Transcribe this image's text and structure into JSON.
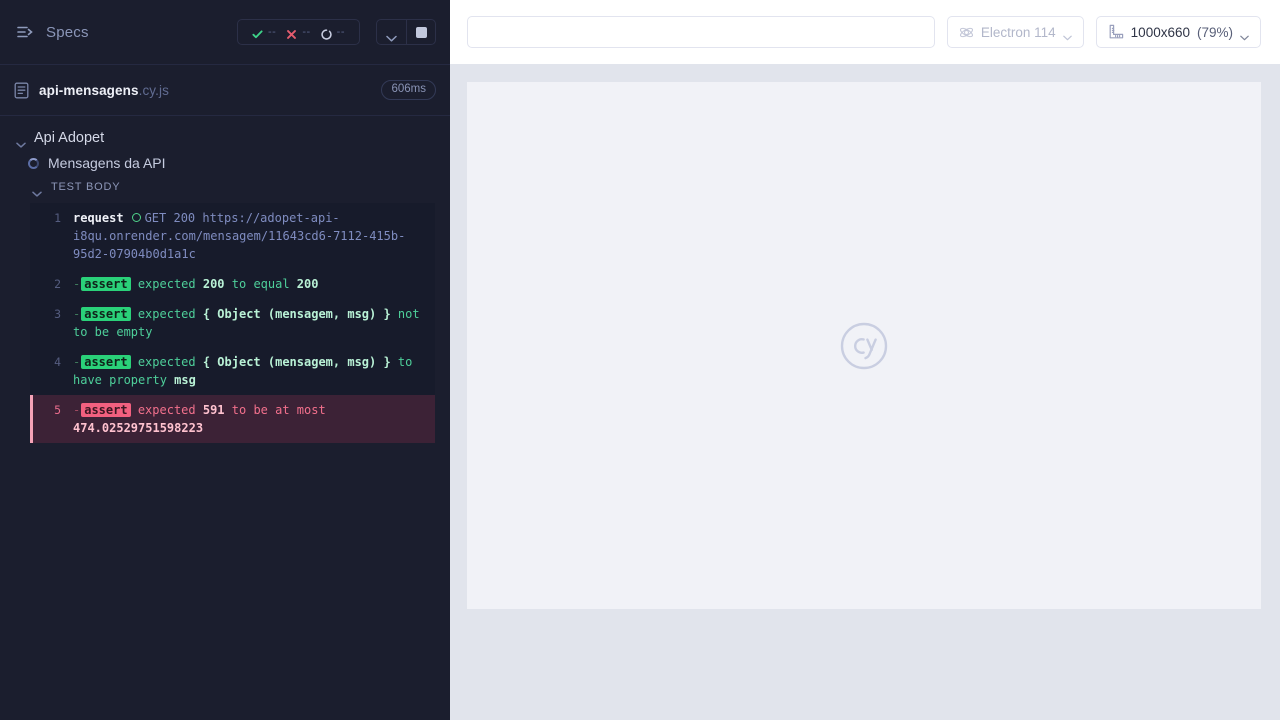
{
  "reporter": {
    "header": {
      "specs_label": "Specs",
      "specs_icon": "specs-list-icon",
      "stats": [
        {
          "icon": "passed-check-icon",
          "value": "--",
          "name": "passed"
        },
        {
          "icon": "failed-x-icon",
          "value": "--",
          "name": "failed"
        },
        {
          "icon": "pending-circle-icon",
          "value": "--",
          "name": "pending"
        }
      ],
      "controls": [
        {
          "icon": "chevron-down-icon",
          "name": "toggle-specs-list"
        },
        {
          "icon": "stop-square-icon",
          "name": "stop-run"
        }
      ]
    },
    "spec": {
      "icon": "file-icon",
      "name": "api-mensagens",
      "extension": ".cy.js",
      "duration": "606ms"
    },
    "suite": {
      "caret_icon": "chevron-down-icon",
      "title": "Api Adopet",
      "test": {
        "status_icon": "running-spinner-icon",
        "title": "Mensagens da API"
      },
      "hook": {
        "caret_icon": "chevron-down-icon",
        "label": "TEST BODY"
      }
    },
    "commands": [
      {
        "number": "1",
        "type": "request",
        "method": "request",
        "status_icon": "green-circle-icon",
        "detail": "GET 200 https://adopet-api-i8qu.onrender.com/mensagem/11643cd6-7112-415b-95d2-07904b0d1a1c",
        "failed": false
      },
      {
        "number": "2",
        "type": "assert",
        "pill": "assert",
        "parts": [
          {
            "t": "expected ",
            "strong": false
          },
          {
            "t": "200",
            "strong": true
          },
          {
            "t": " to equal ",
            "strong": false
          },
          {
            "t": "200",
            "strong": true
          }
        ],
        "failed": false
      },
      {
        "number": "3",
        "type": "assert",
        "pill": "assert",
        "parts": [
          {
            "t": "expected ",
            "strong": false
          },
          {
            "t": "{ Object (mensagem, msg) }",
            "strong": true
          },
          {
            "t": " not to be empty",
            "strong": false
          }
        ],
        "failed": false
      },
      {
        "number": "4",
        "type": "assert",
        "pill": "assert",
        "parts": [
          {
            "t": "expected ",
            "strong": false
          },
          {
            "t": "{ Object (mensagem, msg) }",
            "strong": true
          },
          {
            "t": " to have property ",
            "strong": false
          },
          {
            "t": "msg",
            "strong": true
          }
        ],
        "failed": false
      },
      {
        "number": "5",
        "type": "assert",
        "pill": "assert",
        "parts": [
          {
            "t": "expected ",
            "strong": false
          },
          {
            "t": "591",
            "strong": true
          },
          {
            "t": " to be at most ",
            "strong": false
          },
          {
            "t": "474.02529751598223",
            "strong": true
          }
        ],
        "failed": true
      }
    ]
  },
  "runner": {
    "url_bar": {
      "value": "",
      "placeholder": ""
    },
    "browser_button": {
      "icon": "electron-icon",
      "label": "Electron 114",
      "chevron": "chevron-down-icon"
    },
    "viewport_button": {
      "icon": "ruler-icon",
      "size": "1000x660",
      "scale": "(79%)",
      "chevron": "chevron-down-icon"
    },
    "aut": {
      "watermark": "cy-logo"
    }
  },
  "colors": {
    "reporter_bg": "#1b1e2e",
    "cmdlog_bg": "#171b2b",
    "pass_green": "#2ad179",
    "fail_pink": "#f2607f",
    "fail_row_bg": "#3c2236",
    "runner_bg": "#e1e4ec",
    "aut_bg": "#f1f2f7"
  }
}
